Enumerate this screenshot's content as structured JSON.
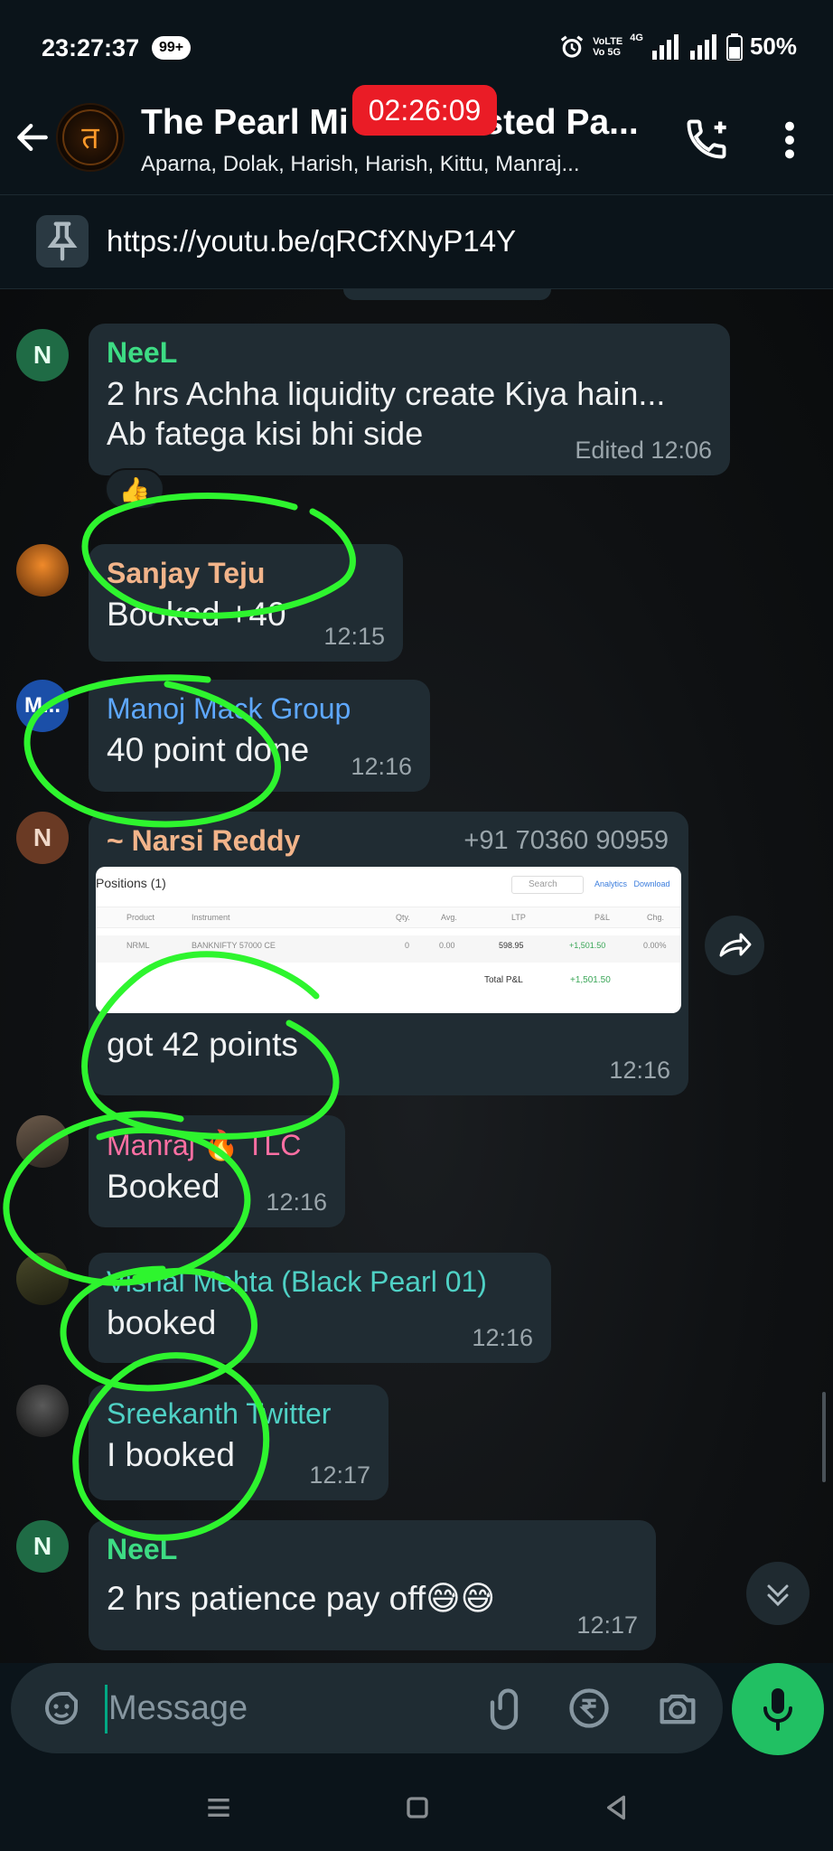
{
  "status": {
    "time": "23:27:37",
    "badge": "99+",
    "volte": "VoLTE",
    "vo5g": "Vo 5G",
    "net": "4G",
    "battery": "50%"
  },
  "header": {
    "title": "The Pearl Mi",
    "title_tail": "ested Pa...",
    "subtitle": "Aparna, Dolak, Harish, Harish, Kittu, Manraj...",
    "timer": "02:26:09",
    "avatar_glyph": "त"
  },
  "pinned": {
    "link": "https://youtu.be/qRCfXNyP14Y"
  },
  "messages": [
    {
      "avatar": "N",
      "sender": "NeeL",
      "text_line1": "2 hrs Achha liquidity create Kiya hain...",
      "text_line2": "Ab fatega kisi bhi side",
      "meta": "Edited 12:06",
      "reaction": "👍",
      "sender_color": "#53bdeb"
    },
    {
      "avatar": "",
      "sender": "Sanjay Teju",
      "text": "Booked +40",
      "meta": "12:15"
    },
    {
      "avatar": "M...",
      "sender": "Manoj Mack Group",
      "text": "40 point done",
      "meta": "12:16"
    },
    {
      "avatar": "N",
      "sender": "~ Narsi Reddy",
      "phone": "+91 70360 90959",
      "text": "got 42 points",
      "meta": "12:16",
      "screenshot": {
        "title": "Positions (1)",
        "search": "Search",
        "analytics": "Analytics",
        "download": "Download",
        "cols": [
          "Product",
          "Instrument",
          "Qty.",
          "Avg.",
          "LTP",
          "P&L",
          "Chg."
        ],
        "row": [
          "NRML",
          "BANKNIFTY 57000 CE",
          "0",
          "0.00",
          "598.95",
          "+1,501.50",
          "0.00%"
        ],
        "total_label": "Total P&L",
        "total_value": "+1,501.50"
      }
    },
    {
      "avatar": "",
      "sender": "Manraj 🔥 TLC",
      "text": "Booked",
      "meta": "12:16"
    },
    {
      "avatar": "",
      "sender": "Vishal Mehta (Black Pearl 01)",
      "text": "booked",
      "meta": "12:16"
    },
    {
      "avatar": "",
      "sender": "Sreekanth Twitter",
      "text": "I booked",
      "meta": "12:17"
    },
    {
      "avatar": "N",
      "sender": "NeeL",
      "text": "2 hrs patience pay off😅😅",
      "meta": "12:17"
    }
  ],
  "composer": {
    "placeholder": "Message"
  },
  "colors": {
    "bg": "#0b141a",
    "bubble": "#202c33",
    "accent_green": "#21c063",
    "timer_red": "#ea1c26",
    "scribble": "#2ef52e"
  },
  "icons": [
    "back-arrow-icon",
    "add-call-icon",
    "more-vert-icon",
    "pin-icon",
    "forward-icon",
    "scroll-down-icon",
    "sticker-icon",
    "attach-icon",
    "rupee-icon",
    "camera-icon",
    "mic-icon",
    "nav-menu-icon",
    "nav-home-icon",
    "nav-back-icon"
  ]
}
